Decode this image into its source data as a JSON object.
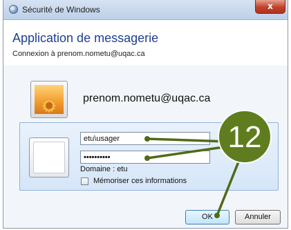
{
  "window": {
    "title": "Sécurité de Windows",
    "close_label": "x"
  },
  "header": {
    "app_title": "Application de messagerie",
    "connection_text": "Connexion à prenom.nometu@uqac.ca"
  },
  "saved_account": {
    "name": "prenom.nometu@uqac.ca"
  },
  "credentials": {
    "username_value": "etu\\usager",
    "password_value": "••••••••••",
    "domain_text": "Domaine : etu",
    "remember_label": "Mémoriser ces informations",
    "remember_checked": false
  },
  "buttons": {
    "ok_label": "OK",
    "cancel_label": "Annuler"
  },
  "annotation": {
    "step_number": "12",
    "color": "#5f7d1e"
  },
  "colors": {
    "title_blue": "#1e3f8f",
    "panel_blue": "#d6e6f8",
    "close_red": "#c0412a"
  },
  "icons": {
    "title": "windows-security-shield-icon",
    "account_tile": "flower-user-picture-icon",
    "new_credential_tile": "blank-user-tile-icon",
    "close": "close-icon",
    "checkbox": "checkbox-icon"
  }
}
